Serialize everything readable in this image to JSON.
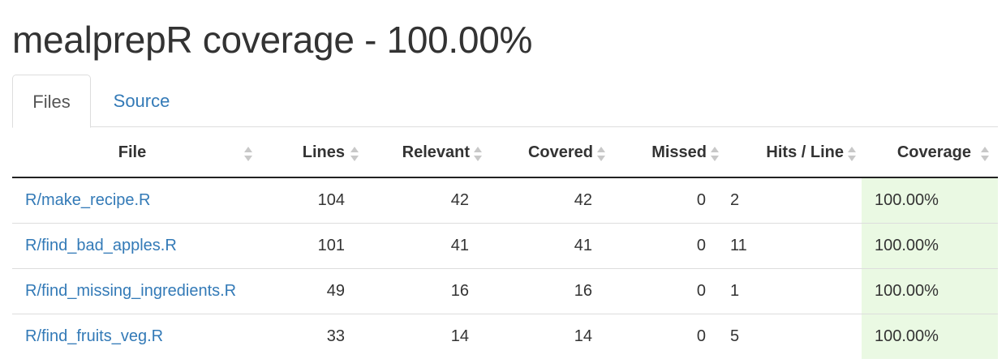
{
  "title": "mealprepR coverage - 100.00%",
  "tabs": [
    {
      "label": "Files",
      "active": true
    },
    {
      "label": "Source",
      "active": false
    }
  ],
  "table": {
    "headers": {
      "file": "File",
      "lines": "Lines",
      "relevant": "Relevant",
      "covered": "Covered",
      "missed": "Missed",
      "hits": "Hits / Line",
      "coverage": "Coverage"
    },
    "rows": [
      {
        "file": "R/make_recipe.R",
        "lines": "104",
        "relevant": "42",
        "covered": "42",
        "missed": "0",
        "hits": "2",
        "coverage": "100.00%"
      },
      {
        "file": "R/find_bad_apples.R",
        "lines": "101",
        "relevant": "41",
        "covered": "41",
        "missed": "0",
        "hits": "11",
        "coverage": "100.00%"
      },
      {
        "file": "R/find_missing_ingredients.R",
        "lines": "49",
        "relevant": "16",
        "covered": "16",
        "missed": "0",
        "hits": "1",
        "coverage": "100.00%"
      },
      {
        "file": "R/find_fruits_veg.R",
        "lines": "33",
        "relevant": "14",
        "covered": "14",
        "missed": "0",
        "hits": "5",
        "coverage": "100.00%"
      }
    ]
  },
  "colors": {
    "link": "#337ab7",
    "coverage_full_bg": "#eaf9e3",
    "header_rule": "#222222"
  }
}
